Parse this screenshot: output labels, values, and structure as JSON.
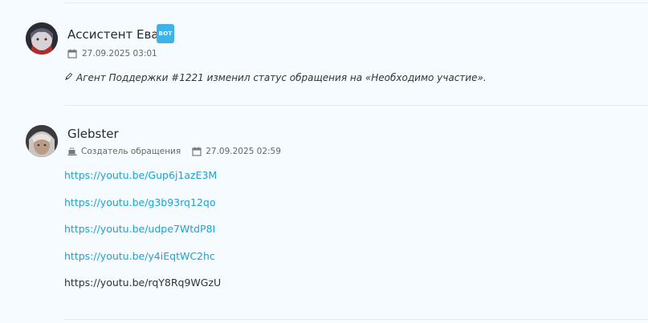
{
  "posts": [
    {
      "author": "Ассистент Ева",
      "badge": "BOT",
      "date": "27.09.2025 03:01",
      "message": "Агент Поддержки #1221 изменил статус обращения на «Необходимо участие»."
    },
    {
      "author": "Glebster",
      "role": "Создатель обращения",
      "date": "27.09.2025 02:59",
      "links": [
        "https://youtu.be/Gup6j1azE3M",
        "https://youtu.be/g3b93rq12qo",
        "https://youtu.be/udpe7WtdP8I",
        "https://youtu.be/y4iEqtWC2hc",
        "https://youtu.be/rqY8Rq9WGzU"
      ]
    }
  ]
}
